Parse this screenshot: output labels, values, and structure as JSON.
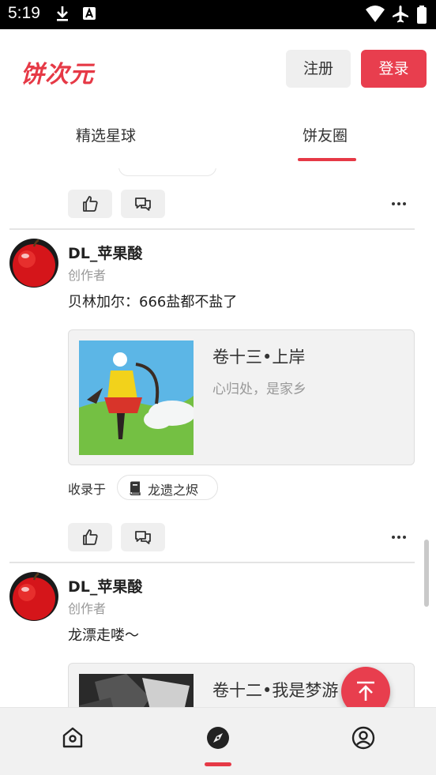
{
  "status_bar": {
    "time": "5:19"
  },
  "header": {
    "logo": "饼次元",
    "register_label": "注册",
    "login_label": "登录"
  },
  "tabs": [
    {
      "label": "精选星球"
    },
    {
      "label": "饼友圈"
    }
  ],
  "posts": [
    {
      "username": "DL_苹果酸",
      "role": "创作者",
      "text": "贝林加尔：666盐都不盐了",
      "card": {
        "title": "卷十三•上岸",
        "subtitle": "心归处，是家乡"
      },
      "collected_label": "收录于",
      "collection_name": "龙遗之烬"
    },
    {
      "username": "DL_苹果酸",
      "role": "创作者",
      "text": "龙漂走喽～",
      "card": {
        "title": "卷十二•我是梦游"
      }
    }
  ],
  "colors": {
    "brand": "#e63946",
    "login_bg": "#e83e4e"
  }
}
